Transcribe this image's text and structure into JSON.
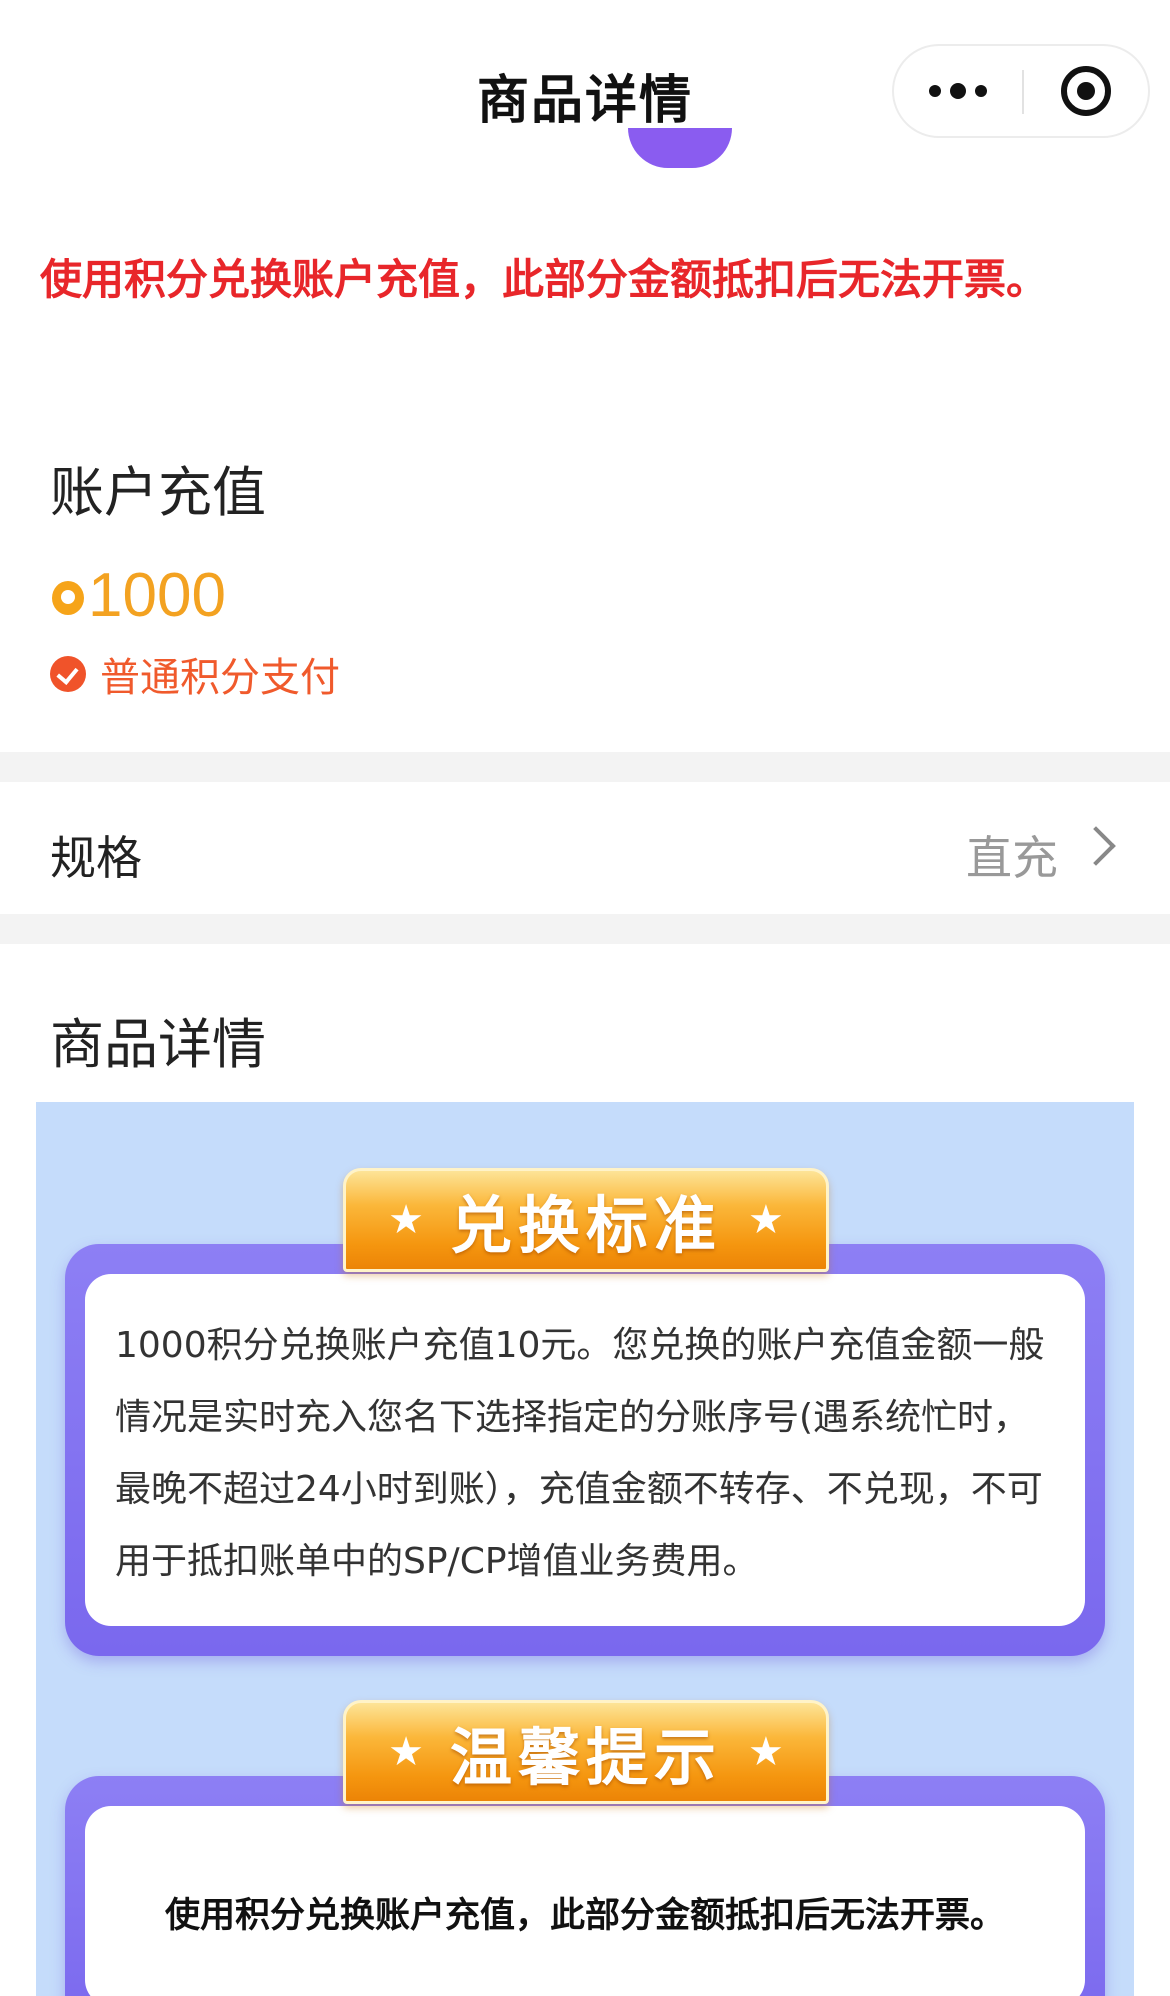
{
  "nav": {
    "title": "商品详情"
  },
  "notice": {
    "warning": "使用积分兑换账户充值，此部分金额抵扣后无法开票。"
  },
  "product": {
    "name": "账户充值",
    "price": "1000",
    "payment_method": "普通积分支付"
  },
  "spec": {
    "label": "规格",
    "value": "直充"
  },
  "details": {
    "heading": "商品详情",
    "cards": [
      {
        "title": "兑换标准",
        "text": "1000积分兑换账户充值10元。您兑换的账户充值金额一般情况是实时充入您名下选择指定的分账序号(遇系统忙时，最晚不超过24小时到账），充值金额不转存、不兑现，不可用于抵扣账单中的SP/CP增值业务费用。"
      },
      {
        "title": "温馨提示",
        "text": "使用积分兑换账户充值，此部分金额抵扣后无法开票。"
      }
    ]
  },
  "icons": [
    "more-dots-icon",
    "close-circle-icon",
    "points-coin-icon",
    "check-circle-icon",
    "chevron-right-icon",
    "star-icon"
  ],
  "colors": {
    "warning_red": "#e8262a",
    "price_orange": "#f3a221",
    "pay_orange": "#f05a2c",
    "card_purple": "#7a68ee",
    "detail_bg": "#c5dcfb",
    "ribbon_gold": "#f5960f"
  }
}
